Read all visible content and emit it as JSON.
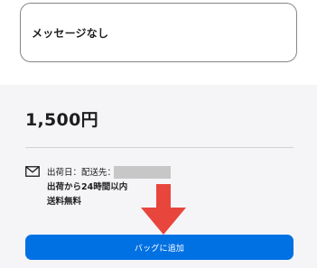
{
  "message": {
    "text": "メッセージなし"
  },
  "purchase": {
    "price": "1,500円",
    "shipping": {
      "icon": "mail-icon",
      "label": "出荷日：配送先：",
      "estimate": "出荷から24時間以内",
      "fee": "送料無料"
    },
    "add_to_bag_label": "バッグに追加"
  },
  "colors": {
    "accent": "#0071e3",
    "panel_bg": "#f5f5f7",
    "arrow": "#e8453c",
    "redaction": "#c7c7c7"
  }
}
